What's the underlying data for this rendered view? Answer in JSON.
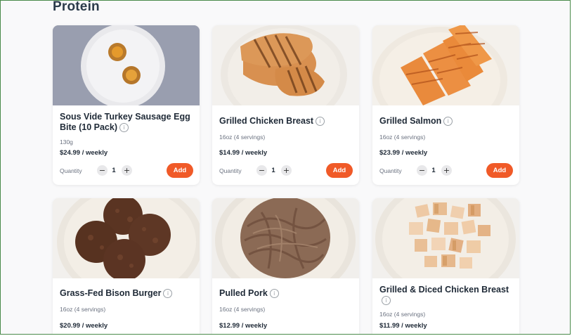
{
  "section": {
    "title": "Protein"
  },
  "products": [
    {
      "name": "Sous Vide Turkey Sausage Egg Bite (10 Pack)",
      "size": "130g",
      "price": "$24.99 / weekly",
      "quantity_label": "Quantity",
      "quantity": "1",
      "add_label": "Add"
    },
    {
      "name": "Grilled Chicken Breast",
      "size": "16oz (4 servings)",
      "price": "$14.99 / weekly",
      "quantity_label": "Quantity",
      "quantity": "1",
      "add_label": "Add"
    },
    {
      "name": "Grilled Salmon",
      "size": "16oz (4 servings)",
      "price": "$23.99 / weekly",
      "quantity_label": "Quantity",
      "quantity": "1",
      "add_label": "Add"
    },
    {
      "name": "Grass-Fed Bison Burger",
      "size": "16oz (4 servings)",
      "price": "$20.99 / weekly"
    },
    {
      "name": "Pulled Pork",
      "size": "16oz (4 servings)",
      "price": "$12.99 / weekly"
    },
    {
      "name": "Grilled & Diced Chicken Breast",
      "size": "16oz (4 servings)",
      "price": "$11.99 / weekly"
    }
  ],
  "icons": {
    "info": "info-icon",
    "minus": "minus-icon",
    "plus": "plus-icon"
  },
  "colors": {
    "accent": "#f05a28",
    "text": "#1f2a37",
    "muted": "#6b7280",
    "frame": "#4a8a4a"
  }
}
